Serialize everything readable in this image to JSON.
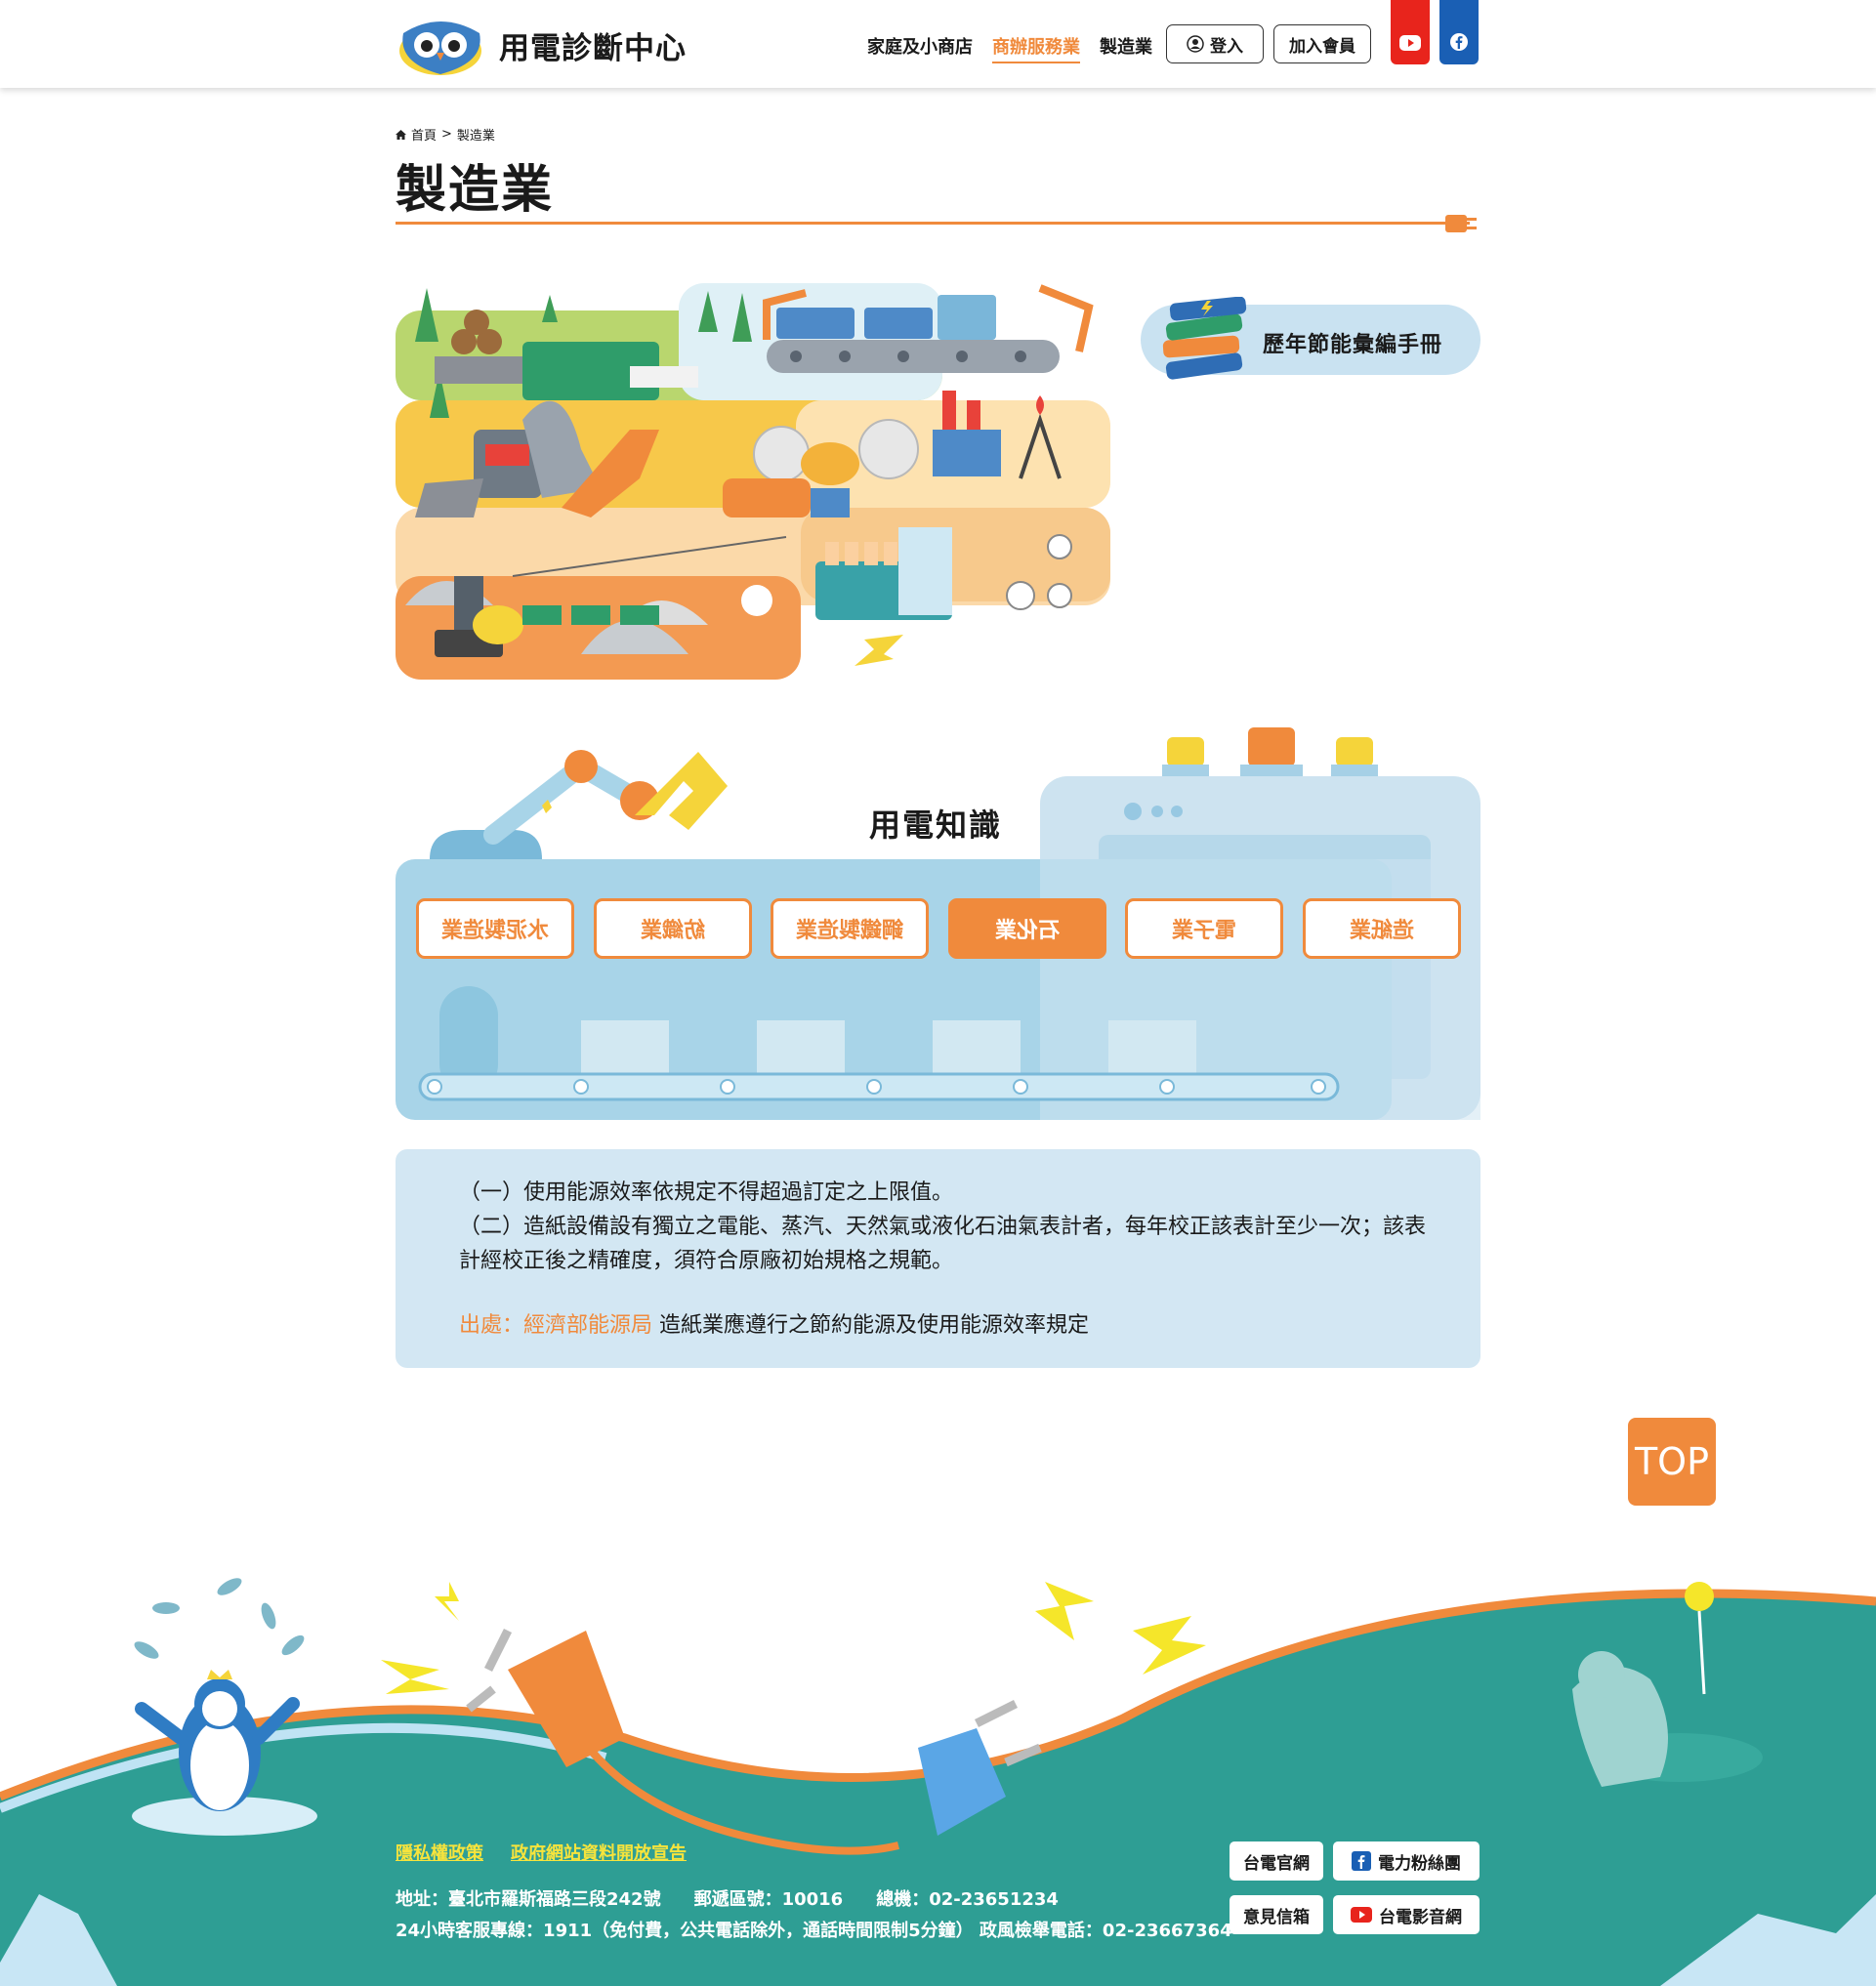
{
  "header": {
    "logo_text": "用電診斷中心",
    "nav": [
      "家庭及小商店",
      "商辦服務業",
      "製造業"
    ],
    "login": "登入",
    "join": "加入會員",
    "youtube_color": "#e8241c",
    "facebook_color": "#1a5fb4"
  },
  "breadcrumb": {
    "home": "首頁",
    "sep": ">",
    "current": "製造業"
  },
  "page_title": "製造業",
  "handbook": {
    "label": "歷年節能彙編手冊"
  },
  "knowledge": {
    "title": "用電知識",
    "categories": [
      "水泥製造業",
      "紡織業",
      "鋼鐵製造業",
      "石化業",
      "電子業",
      "造紙業"
    ],
    "active_index": 3
  },
  "info": {
    "line1": "（一）使用能源效率依規定不得超過訂定之上限值。",
    "line2": "（二）造紙設備設有獨立之電能、蒸汽、天然氣或液化石油氣表計者，每年校正該表計至少一次；該表計經校正後之精確度，須符合原廠初始規格之規範。",
    "source_label": "出處：經濟部能源局",
    "source_text": "造紙業應遵行之節約能源及使用能源效率規定"
  },
  "top_button": "TOP",
  "footer": {
    "links": [
      "隱私權政策",
      "政府網站資料開放宣告"
    ],
    "address": "地址：臺北市羅斯福路三段242號",
    "postal": "郵遞區號：10016",
    "switchboard": "總機：02-23651234",
    "hotline": "24小時客服專線：1911（免付費，公共電話除外，通話時間限制5分鐘） 政風檢舉電話：02-23667364",
    "buttons": [
      "台電官網",
      "電力粉絲團",
      "意見信箱",
      "台電影音網"
    ],
    "teal": "#2e9e94",
    "accent": "#f08a3c"
  }
}
